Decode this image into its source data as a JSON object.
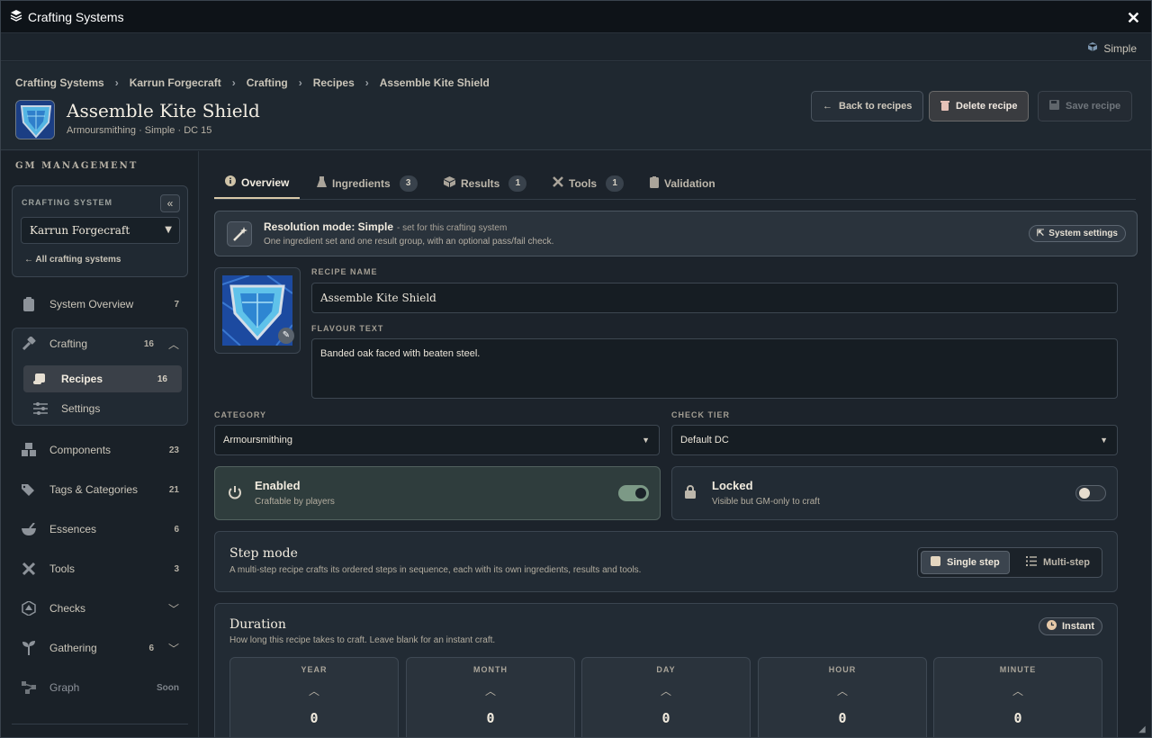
{
  "window": {
    "title": "Crafting Systems",
    "close_glyph": "✕"
  },
  "subbar": {
    "mode_label": "Simple"
  },
  "breadcrumb": [
    "Crafting Systems",
    "Karrun Forgecraft",
    "Crafting",
    "Recipes",
    "Assemble Kite Shield"
  ],
  "header": {
    "title": "Assemble Kite Shield",
    "subtitle": "Armoursmithing · Simple · DC 15",
    "back_label": "Back to recipes",
    "delete_label": "Delete recipe",
    "save_label": "Save recipe"
  },
  "sidebar": {
    "section_title": "GM MANAGEMENT",
    "crafting_system_label": "CRAFTING SYSTEM",
    "crafting_system_value": "Karrun Forgecraft",
    "all_systems_label": "All crafting systems",
    "items": [
      {
        "label": "System Overview",
        "count": "7",
        "icon": "clipboard-icon"
      },
      {
        "label": "Crafting",
        "count": "16",
        "icon": "hammer-icon"
      },
      {
        "label": "Recipes",
        "count": "16",
        "icon": "scroll-icon"
      },
      {
        "label": "Settings",
        "count": "",
        "icon": "sliders-icon"
      },
      {
        "label": "Components",
        "count": "23",
        "icon": "boxes-icon"
      },
      {
        "label": "Tags & Categories",
        "count": "21",
        "icon": "tags-icon"
      },
      {
        "label": "Essences",
        "count": "6",
        "icon": "mortar-icon"
      },
      {
        "label": "Tools",
        "count": "3",
        "icon": "tools-icon"
      },
      {
        "label": "Checks",
        "count": "",
        "icon": "dice-icon"
      },
      {
        "label": "Gathering",
        "count": "6",
        "icon": "sprout-icon"
      },
      {
        "label": "Graph",
        "count": "Soon",
        "icon": "graph-icon"
      }
    ]
  },
  "tabs": [
    {
      "label": "Overview",
      "badge": ""
    },
    {
      "label": "Ingredients",
      "badge": "3"
    },
    {
      "label": "Results",
      "badge": "1"
    },
    {
      "label": "Tools",
      "badge": "1"
    },
    {
      "label": "Validation",
      "badge": ""
    }
  ],
  "resolution": {
    "title": "Resolution mode: Simple",
    "note": "- set for this crafting system",
    "desc": "One ingredient set and one result group, with an optional pass/fail check.",
    "settings_label": "System settings"
  },
  "form": {
    "recipe_name_label": "RECIPE NAME",
    "recipe_name_value": "Assemble Kite Shield",
    "flavour_label": "FLAVOUR TEXT",
    "flavour_value": "Banded oak faced with beaten steel.",
    "category_label": "CATEGORY",
    "category_value": "Armoursmithing",
    "check_tier_label": "CHECK TIER",
    "check_tier_value": "Default DC"
  },
  "enabled": {
    "title": "Enabled",
    "desc": "Craftable by players",
    "on": true
  },
  "locked": {
    "title": "Locked",
    "desc": "Visible but GM-only to craft",
    "on": false
  },
  "step_mode": {
    "title": "Step mode",
    "desc": "A multi-step recipe crafts its ordered steps in sequence, each with its own ingredients, results and tools.",
    "single_label": "Single step",
    "multi_label": "Multi-step"
  },
  "duration": {
    "title": "Duration",
    "desc": "How long this recipe takes to craft. Leave blank for an instant craft.",
    "instant_label": "Instant",
    "units": [
      {
        "label": "YEAR",
        "value": "0"
      },
      {
        "label": "MONTH",
        "value": "0"
      },
      {
        "label": "DAY",
        "value": "0"
      },
      {
        "label": "HOUR",
        "value": "0"
      },
      {
        "label": "MINUTE",
        "value": "0"
      }
    ]
  }
}
